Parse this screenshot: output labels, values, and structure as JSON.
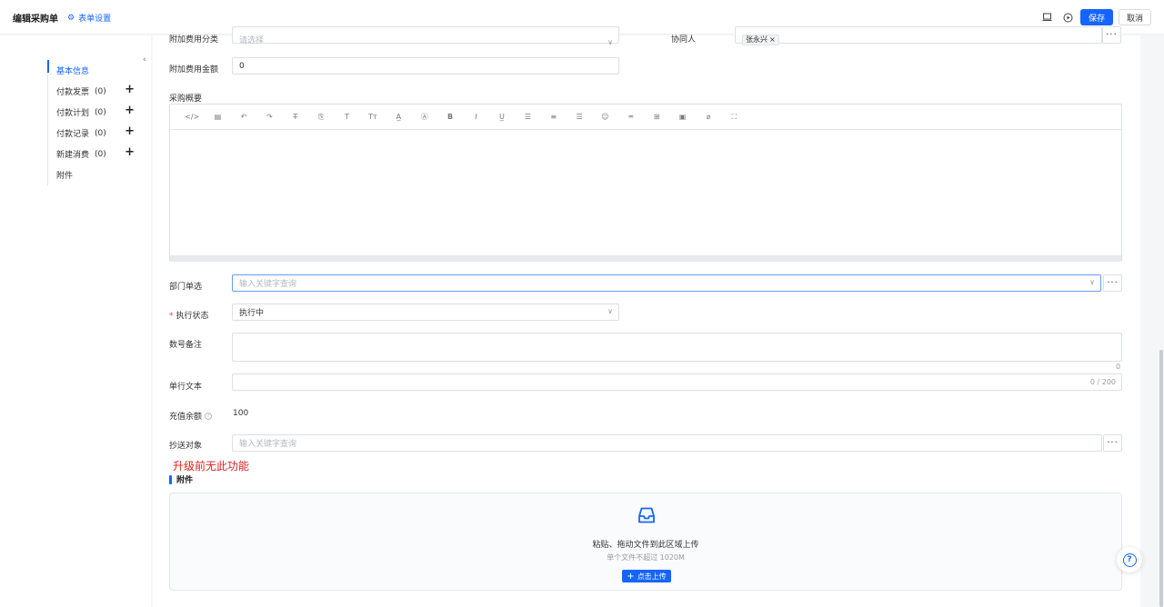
{
  "header": {
    "title": "编辑采购单",
    "form_settings": "表单设置",
    "save_label": "保存",
    "cancel_label": "取消"
  },
  "sidebar": {
    "items": [
      {
        "label": "基本信息",
        "count": "",
        "plus": false,
        "active": true
      },
      {
        "label": "付款发票",
        "count": "(0)",
        "plus": true
      },
      {
        "label": "付款计划",
        "count": "(0)",
        "plus": true
      },
      {
        "label": "付款记录",
        "count": "(0)",
        "plus": true
      },
      {
        "label": "新建消费",
        "count": "(0)",
        "plus": true
      },
      {
        "label": "附件",
        "count": "",
        "plus": false
      }
    ]
  },
  "form": {
    "extra_fee_category": {
      "label": "附加费用分类",
      "placeholder": "请选择"
    },
    "collaborator": {
      "label": "协同人",
      "tag": "张永兴"
    },
    "extra_fee_amount": {
      "label": "附加费用金额",
      "value": "0"
    },
    "purchase_summary": {
      "label": "采购概要"
    },
    "department": {
      "label": "部门单选",
      "placeholder": "输入关键字查询"
    },
    "exec_status": {
      "label": "执行状态",
      "value": "执行中"
    },
    "number_note": {
      "label": "数号备注",
      "counter": "0"
    },
    "single_line": {
      "label": "单行文本",
      "counter": "0 / 200"
    },
    "recharge_balance": {
      "label": "充值余额",
      "value": "100"
    },
    "cc_target": {
      "label": "抄送对象",
      "placeholder": "输入关键字查询"
    }
  },
  "upgrade_notice": "升级前无此功能",
  "attachments": {
    "title": "附件",
    "drop_text": "粘贴、拖动文件到此区域上传",
    "limit_text": "单个文件不超过 1020M",
    "upload_button": "点击上传"
  },
  "toolbar_icons": [
    "code-icon",
    "template-icon",
    "undo-icon",
    "redo-icon",
    "strikethrough-icon",
    "clear-format-icon",
    "font-size-icon",
    "text-transform-icon",
    "font-color-icon",
    "background-color-icon",
    "bold-icon",
    "italic-icon",
    "underline-icon",
    "align-left-icon",
    "align-center-icon",
    "align-right-icon",
    "emoji-icon",
    "horizontal-rule-icon",
    "table-icon",
    "image-icon",
    "attachment-icon",
    "fullscreen-icon"
  ]
}
